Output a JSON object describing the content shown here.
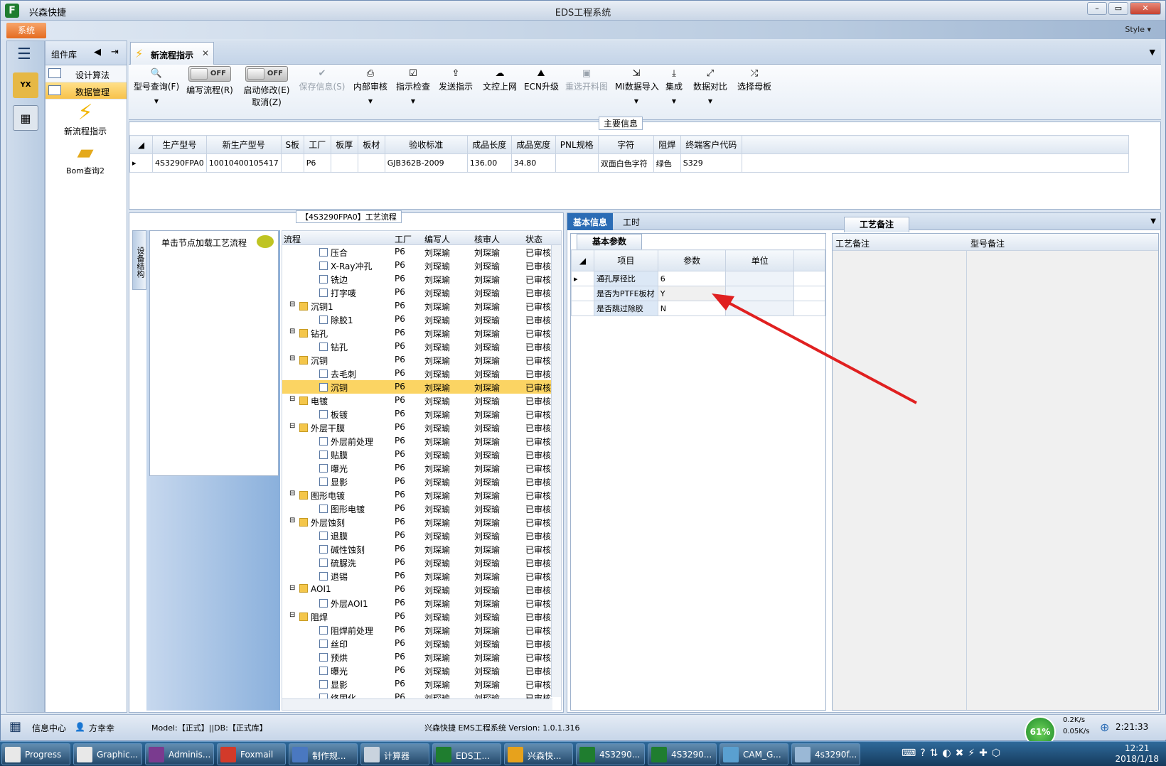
{
  "window": {
    "app_name": "兴森快捷",
    "title": "EDS工程系统",
    "style_label": "Style ▾"
  },
  "menu": {
    "system_button": "系统"
  },
  "comp_lib": {
    "title": "组件库",
    "items": [
      {
        "label": "设计算法",
        "active": false
      },
      {
        "label": "数据管理",
        "active": true
      }
    ],
    "shortcuts": [
      {
        "label": "新流程指示",
        "icon": "lightning-icon"
      },
      {
        "label": "Bom查询2",
        "icon": "folder-icon"
      }
    ]
  },
  "tab": {
    "label": "新流程指示"
  },
  "toolbar": {
    "model_query": "型号查询(F)",
    "edit_flow_toggle": "OFF",
    "edit_flow": "编写流程(R)",
    "start_edit_toggle": "OFF",
    "start_edit": "启动修改(E)",
    "cancel": "取消(Z)",
    "save_info": "保存信息(S)",
    "internal_review": "内部审核",
    "instruction_check": "指示检查",
    "send_instruction": "发送指示",
    "doc_upload": "文控上网",
    "ecn_upgrade": "ECN升级",
    "reselect_drawing": "重选开料图",
    "mi_import": "MI数据导入",
    "integrate": "集成",
    "data_compare": "数据对比",
    "select_master": "选择母板"
  },
  "main_info": {
    "legend": "主要信息",
    "columns": [
      "生产型号",
      "新生产型号",
      "S板",
      "工厂",
      "板厚",
      "板材",
      "验收标准",
      "成品长度",
      "成品宽度",
      "PNL规格",
      "字符",
      "阻焊",
      "终端客户代码"
    ],
    "row": [
      "4S3290FPA0",
      "10010400105417",
      "",
      "P6",
      "",
      "",
      "GJB362B-2009",
      "136.00",
      "34.80",
      "",
      "双面白色字符",
      "绿色",
      "S329"
    ]
  },
  "flow_panel": {
    "legend": "【4S3290FPA0】工艺流程",
    "side_tab": "设备结构",
    "click_hint": "单击节点加载工艺流程",
    "columns": [
      "流程",
      "工厂",
      "编写人",
      "核审人",
      "状态"
    ],
    "rows": [
      {
        "name": "压合",
        "level": 2,
        "type": "doc",
        "factory": "P6",
        "writer": "刘琛瑜",
        "reviewer": "刘琛瑜",
        "status": "已审核",
        "selected": false
      },
      {
        "name": "X-Ray冲孔",
        "level": 2,
        "type": "doc",
        "factory": "P6",
        "writer": "刘琛瑜",
        "reviewer": "刘琛瑜",
        "status": "已审核",
        "selected": false
      },
      {
        "name": "铣边",
        "level": 2,
        "type": "doc",
        "factory": "P6",
        "writer": "刘琛瑜",
        "reviewer": "刘琛瑜",
        "status": "已审核",
        "selected": false
      },
      {
        "name": "打字唛",
        "level": 2,
        "type": "doc",
        "factory": "P6",
        "writer": "刘琛瑜",
        "reviewer": "刘琛瑜",
        "status": "已审核",
        "selected": false
      },
      {
        "name": "沉铜1",
        "level": 1,
        "type": "folder",
        "factory": "P6",
        "writer": "刘琛瑜",
        "reviewer": "刘琛瑜",
        "status": "已审核",
        "selected": false
      },
      {
        "name": "除胶1",
        "level": 2,
        "type": "doc",
        "factory": "P6",
        "writer": "刘琛瑜",
        "reviewer": "刘琛瑜",
        "status": "已审核",
        "selected": false
      },
      {
        "name": "钻孔",
        "level": 1,
        "type": "folder",
        "factory": "P6",
        "writer": "刘琛瑜",
        "reviewer": "刘琛瑜",
        "status": "已审核",
        "selected": false
      },
      {
        "name": "钻孔",
        "level": 2,
        "type": "doc",
        "factory": "P6",
        "writer": "刘琛瑜",
        "reviewer": "刘琛瑜",
        "status": "已审核",
        "selected": false
      },
      {
        "name": "沉铜",
        "level": 1,
        "type": "folder",
        "factory": "P6",
        "writer": "刘琛瑜",
        "reviewer": "刘琛瑜",
        "status": "已审核",
        "selected": false
      },
      {
        "name": "去毛刺",
        "level": 2,
        "type": "doc",
        "factory": "P6",
        "writer": "刘琛瑜",
        "reviewer": "刘琛瑜",
        "status": "已审核",
        "selected": false
      },
      {
        "name": "沉铜",
        "level": 2,
        "type": "doc",
        "factory": "P6",
        "writer": "刘琛瑜",
        "reviewer": "刘琛瑜",
        "status": "已审核",
        "selected": true
      },
      {
        "name": "电镀",
        "level": 1,
        "type": "folder",
        "factory": "P6",
        "writer": "刘琛瑜",
        "reviewer": "刘琛瑜",
        "status": "已审核",
        "selected": false
      },
      {
        "name": "板镀",
        "level": 2,
        "type": "doc",
        "factory": "P6",
        "writer": "刘琛瑜",
        "reviewer": "刘琛瑜",
        "status": "已审核",
        "selected": false
      },
      {
        "name": "外层干膜",
        "level": 1,
        "type": "folder",
        "factory": "P6",
        "writer": "刘琛瑜",
        "reviewer": "刘琛瑜",
        "status": "已审核",
        "selected": false
      },
      {
        "name": "外层前处理",
        "level": 2,
        "type": "doc",
        "factory": "P6",
        "writer": "刘琛瑜",
        "reviewer": "刘琛瑜",
        "status": "已审核",
        "selected": false
      },
      {
        "name": "贴膜",
        "level": 2,
        "type": "doc",
        "factory": "P6",
        "writer": "刘琛瑜",
        "reviewer": "刘琛瑜",
        "status": "已审核",
        "selected": false
      },
      {
        "name": "曝光",
        "level": 2,
        "type": "doc",
        "factory": "P6",
        "writer": "刘琛瑜",
        "reviewer": "刘琛瑜",
        "status": "已审核",
        "selected": false
      },
      {
        "name": "显影",
        "level": 2,
        "type": "doc",
        "factory": "P6",
        "writer": "刘琛瑜",
        "reviewer": "刘琛瑜",
        "status": "已审核",
        "selected": false
      },
      {
        "name": "图形电镀",
        "level": 1,
        "type": "folder",
        "factory": "P6",
        "writer": "刘琛瑜",
        "reviewer": "刘琛瑜",
        "status": "已审核",
        "selected": false
      },
      {
        "name": "图形电镀",
        "level": 2,
        "type": "doc",
        "factory": "P6",
        "writer": "刘琛瑜",
        "reviewer": "刘琛瑜",
        "status": "已审核",
        "selected": false
      },
      {
        "name": "外层蚀刻",
        "level": 1,
        "type": "folder",
        "factory": "P6",
        "writer": "刘琛瑜",
        "reviewer": "刘琛瑜",
        "status": "已审核",
        "selected": false
      },
      {
        "name": "退膜",
        "level": 2,
        "type": "doc",
        "factory": "P6",
        "writer": "刘琛瑜",
        "reviewer": "刘琛瑜",
        "status": "已审核",
        "selected": false
      },
      {
        "name": "碱性蚀刻",
        "level": 2,
        "type": "doc",
        "factory": "P6",
        "writer": "刘琛瑜",
        "reviewer": "刘琛瑜",
        "status": "已审核",
        "selected": false
      },
      {
        "name": "硫脲洗",
        "level": 2,
        "type": "doc",
        "factory": "P6",
        "writer": "刘琛瑜",
        "reviewer": "刘琛瑜",
        "status": "已审核",
        "selected": false
      },
      {
        "name": "退锡",
        "level": 2,
        "type": "doc",
        "factory": "P6",
        "writer": "刘琛瑜",
        "reviewer": "刘琛瑜",
        "status": "已审核",
        "selected": false
      },
      {
        "name": "AOI1",
        "level": 1,
        "type": "folder",
        "factory": "P6",
        "writer": "刘琛瑜",
        "reviewer": "刘琛瑜",
        "status": "已审核",
        "selected": false
      },
      {
        "name": "外层AOI1",
        "level": 2,
        "type": "doc",
        "factory": "P6",
        "writer": "刘琛瑜",
        "reviewer": "刘琛瑜",
        "status": "已审核",
        "selected": false
      },
      {
        "name": "阻焊",
        "level": 1,
        "type": "folder",
        "factory": "P6",
        "writer": "刘琛瑜",
        "reviewer": "刘琛瑜",
        "status": "已审核",
        "selected": false
      },
      {
        "name": "阻焊前处理",
        "level": 2,
        "type": "doc",
        "factory": "P6",
        "writer": "刘琛瑜",
        "reviewer": "刘琛瑜",
        "status": "已审核",
        "selected": false
      },
      {
        "name": "丝印",
        "level": 2,
        "type": "doc",
        "factory": "P6",
        "writer": "刘琛瑜",
        "reviewer": "刘琛瑜",
        "status": "已审核",
        "selected": false
      },
      {
        "name": "预烘",
        "level": 2,
        "type": "doc",
        "factory": "P6",
        "writer": "刘琛瑜",
        "reviewer": "刘琛瑜",
        "status": "已审核",
        "selected": false
      },
      {
        "name": "曝光",
        "level": 2,
        "type": "doc",
        "factory": "P6",
        "writer": "刘琛瑜",
        "reviewer": "刘琛瑜",
        "status": "已审核",
        "selected": false
      },
      {
        "name": "显影",
        "level": 2,
        "type": "doc",
        "factory": "P6",
        "writer": "刘琛瑜",
        "reviewer": "刘琛瑜",
        "status": "已审核",
        "selected": false
      },
      {
        "name": "终固化",
        "level": 2,
        "type": "doc",
        "factory": "P6",
        "writer": "刘琛瑜",
        "reviewer": "刘琛瑜",
        "status": "已审核",
        "selected": false
      }
    ]
  },
  "right_panel": {
    "tabs": [
      "基本信息",
      "工时"
    ],
    "basic_params": {
      "tab": "基本参数",
      "columns": [
        "项目",
        "参数",
        "单位"
      ],
      "rows": [
        {
          "item": "通孔厚径比",
          "param": "6",
          "unit": ""
        },
        {
          "item": "是否为PTFE板材",
          "param": "Y",
          "unit": ""
        },
        {
          "item": "是否跳过除胶",
          "param": "N",
          "unit": ""
        }
      ]
    },
    "process_notes": {
      "tab": "工艺备注",
      "col1": "工艺备注",
      "col2": "型号备注"
    }
  },
  "statusbar": {
    "info_center": "信息中心",
    "user": "方幸幸",
    "model": "Model:【正式】||DB:【正式库】",
    "version": "兴森快捷 EMS工程系统 Version: 1.0.1.316",
    "gauge": "61%",
    "up": "0.2K/s",
    "down": "0.05K/s",
    "time": "2:21:33"
  },
  "taskbar": {
    "items": [
      "Progress",
      "Graphic...",
      "Adminis...",
      "Foxmail",
      "制作规...",
      "计算器",
      "EDS工...",
      "兴森快...",
      "4S3290...",
      "4S3290...",
      "CAM_G...",
      "4s3290f..."
    ],
    "clock_time": "12:21",
    "clock_date": "2018/1/18"
  },
  "colors": {
    "accent": "#2b6cb5",
    "selected_row": "#fbd463",
    "system_button": "#e46b20",
    "arrow": "#e02020"
  }
}
